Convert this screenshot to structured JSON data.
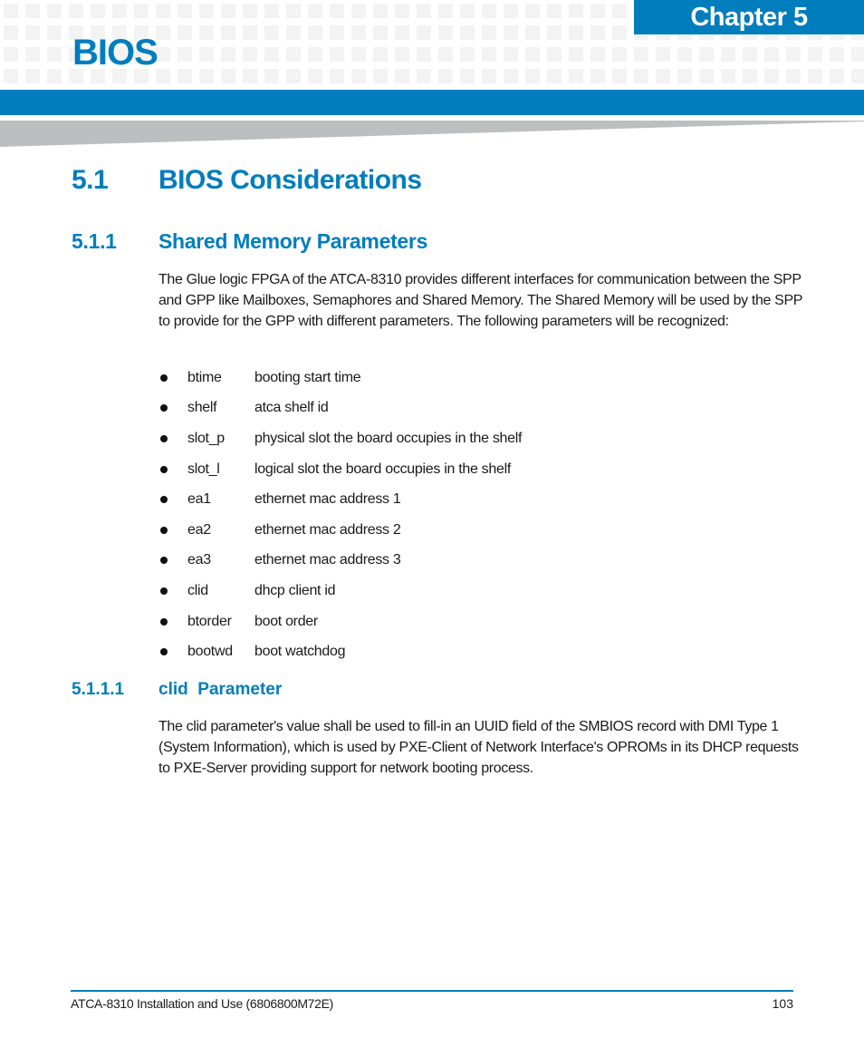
{
  "header": {
    "chapter_label": "Chapter 5",
    "chapter_title": "BIOS",
    "accent_color": "#007dbd"
  },
  "section": {
    "number": "5.1",
    "title": "BIOS Considerations"
  },
  "subsection": {
    "number": "5.1.1",
    "title": "Shared Memory Parameters",
    "intro": "The Glue logic FPGA of the ATCA-8310 provides different interfaces for communication between the SPP and GPP like Mailboxes, Semaphores and Shared Memory. The Shared Memory will be used by the SPP to provide for the GPP with different parameters. The following parameters will be recognized:",
    "parameters": [
      {
        "name": "btime",
        "description": "booting start time"
      },
      {
        "name": "shelf",
        "description": "atca shelf id"
      },
      {
        "name": "slot_p",
        "description": "physical slot the board occupies in the shelf"
      },
      {
        "name": "slot_l",
        "description": "logical slot the board occupies in the shelf"
      },
      {
        "name": "ea1",
        "description": "ethernet mac address 1"
      },
      {
        "name": "ea2",
        "description": "ethernet mac address 2"
      },
      {
        "name": "ea3",
        "description": "ethernet mac address 3"
      },
      {
        "name": "clid",
        "description": "dhcp client id"
      },
      {
        "name": "btorder",
        "description": "boot order"
      },
      {
        "name": "bootwd",
        "description": "boot watchdog"
      }
    ]
  },
  "subsubsection": {
    "number": "5.1.1.1",
    "title": "clid  Parameter",
    "body": "The clid parameter's value shall be used to fill-in an UUID field of the SMBIOS record with DMI Type 1 (System Information), which is used by PXE-Client of Network Interface's OPROMs in its DHCP requests to PXE-Server providing support for network booting process."
  },
  "footer": {
    "document": "ATCA-8310 Installation and Use (6806800M72E)",
    "page_number": "103"
  }
}
